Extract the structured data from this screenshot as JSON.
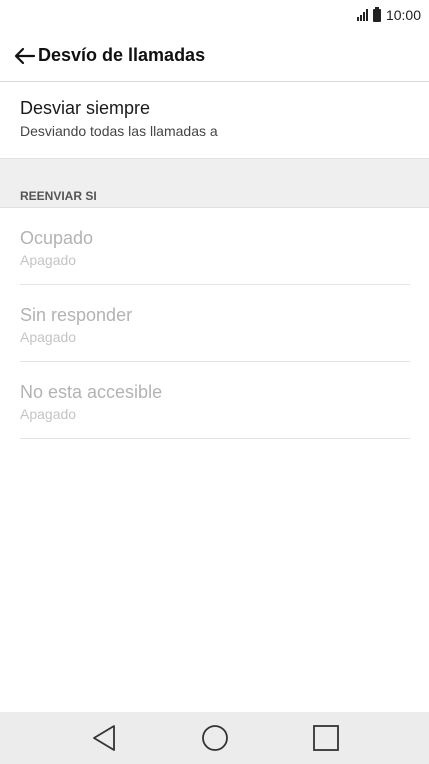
{
  "status_bar": {
    "time": "10:00",
    "icons": [
      "signal-icon",
      "battery-icon"
    ]
  },
  "app_bar": {
    "back_icon": "arrow-left-icon",
    "title": "Desvío de llamadas"
  },
  "always_forward": {
    "title": "Desviar siempre",
    "summary": "Desviando todas las llamadas a"
  },
  "forward_if_section": {
    "header": "REENVIAR SI",
    "items": [
      {
        "title": "Ocupado",
        "summary": "Apagado",
        "enabled": false
      },
      {
        "title": "Sin responder",
        "summary": "Apagado",
        "enabled": false
      },
      {
        "title": "No esta accesible",
        "summary": "Apagado",
        "enabled": false
      }
    ]
  },
  "nav_bar": {
    "buttons": [
      "back-triangle-icon",
      "home-circle-icon",
      "recents-square-icon"
    ]
  },
  "colors": {
    "text_primary": "#1a1a1a",
    "text_disabled": "#b3b3b3",
    "section_bg": "#efefef",
    "nav_bg": "#ececec"
  }
}
